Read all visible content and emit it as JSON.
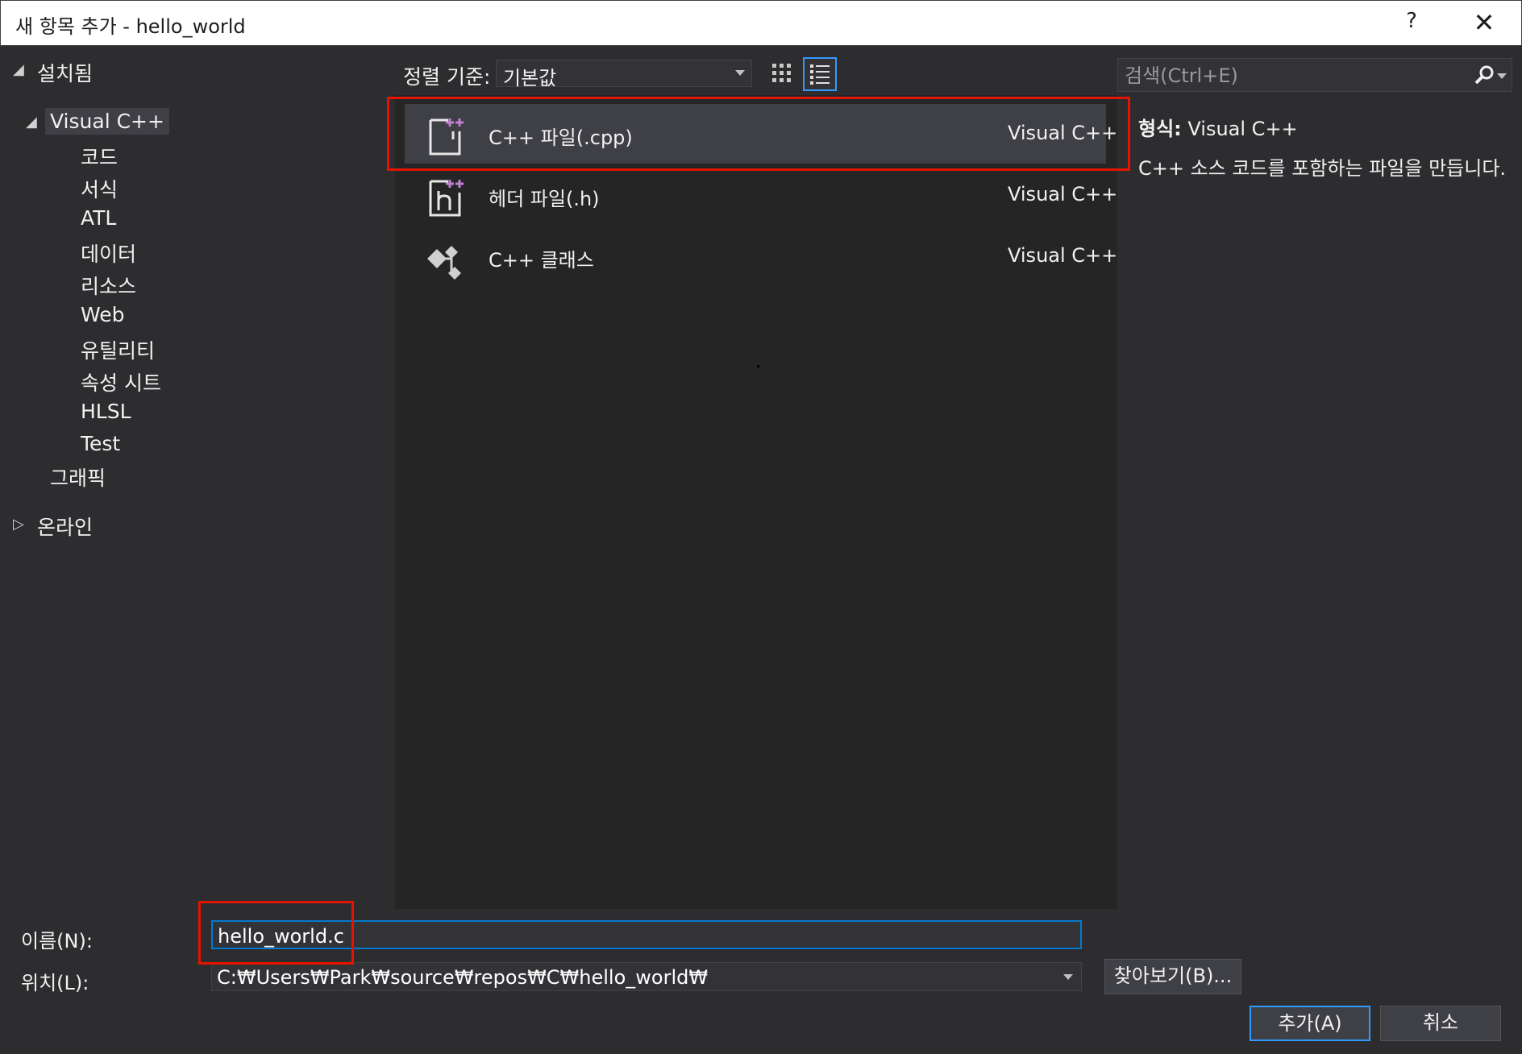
{
  "window": {
    "title": "새 항목 추가 - hello_world",
    "help_label": "?",
    "close_label": "✕"
  },
  "tree": {
    "installed": "설치됨",
    "visual_cpp": "Visual C++",
    "children": [
      "코드",
      "서식",
      "ATL",
      "데이터",
      "리소스",
      "Web",
      "유틸리티",
      "속성 시트",
      "HLSL",
      "Test"
    ],
    "graphics": "그래픽",
    "online": "온라인"
  },
  "sort": {
    "label": "정렬 기준:",
    "value": "기본값"
  },
  "templates": [
    {
      "name": "C++ 파일(.cpp)",
      "type": "Visual C++",
      "icon": "cpp-file-icon"
    },
    {
      "name": "헤더 파일(.h)",
      "type": "Visual C++",
      "icon": "header-file-icon"
    },
    {
      "name": "C++ 클래스",
      "type": "Visual C++",
      "icon": "cpp-class-icon"
    }
  ],
  "search": {
    "placeholder": "검색(Ctrl+E)"
  },
  "details": {
    "type_label": "형식:",
    "type_value": "Visual C++",
    "description": "C++ 소스 코드를 포함하는 파일을 만듭니다."
  },
  "form": {
    "name_label": "이름(N):",
    "name_value": "hello_world.c",
    "location_label": "위치(L):",
    "location_value": "C:₩Users₩Park₩source₩repos₩C₩hello_world₩",
    "browse_label": "찾아보기(B)...",
    "add_label": "추가(A)",
    "cancel_label": "취소"
  },
  "colors": {
    "accent": "#3399ff",
    "highlight_box": "#e51400",
    "background": "#2d2d30",
    "list_background": "#252526",
    "icon_plus": "#c27fd2"
  }
}
